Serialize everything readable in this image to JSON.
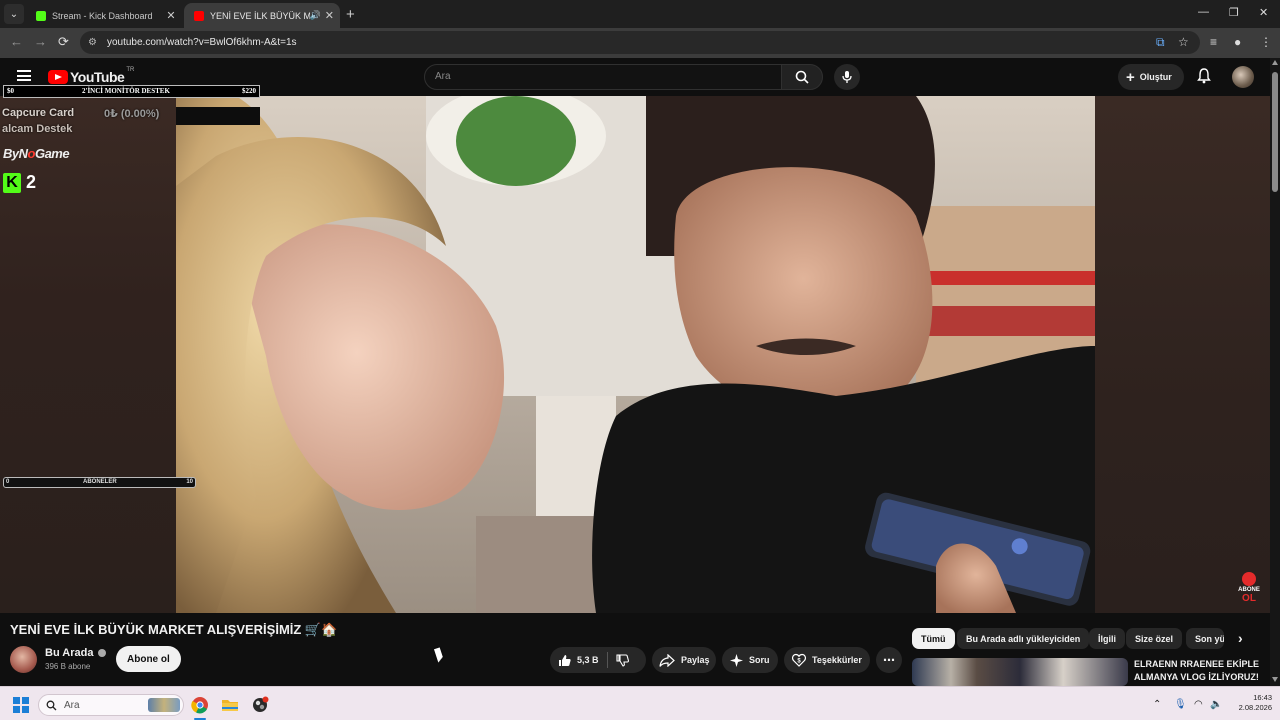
{
  "browser": {
    "tabs": [
      {
        "title": "Stream - Kick Dashboard"
      },
      {
        "title": "YENİ EVE İLK BÜYÜK MARKET ALIŞVERİŞİMİZ"
      }
    ],
    "url": "youtube.com/watch?v=BwlOf6khm-A&t=1s"
  },
  "youtube": {
    "logo_text": "YouTube",
    "country_code": "TR",
    "search_placeholder": "Ara",
    "create_label": "Oluştur"
  },
  "overlay": {
    "goal": {
      "start": "$0",
      "label": "2'İNCİ MONİTÖR DESTEK",
      "end": "$220"
    },
    "capture_card_label": "Capcure Card",
    "capture_card_value": "0₺ (0.00%)",
    "destek_label": "alcam Destek",
    "sponsor": {
      "a": "ByN",
      "b": "o",
      "c": "Game"
    },
    "kick_count": "2",
    "sub_goal": {
      "start": "0",
      "label": "ABONELER",
      "end": "10"
    },
    "abone_top": "ABONE",
    "abone_bottom": "OL"
  },
  "video": {
    "title": "YENİ EVE İLK BÜYÜK MARKET ALIŞVERİŞİMİZ 🛒🏠",
    "channel": "Bu Arada",
    "subscribers": "396 B abone",
    "subscribe_label": "Abone ol",
    "likes": "5,3 B",
    "share_label": "Paylaş",
    "ask_label": "Soru",
    "thanks_label": "Teşekkürler"
  },
  "chips": [
    {
      "label": "Tümü",
      "active": true
    },
    {
      "label": "Bu Arada adlı yükleyiciden"
    },
    {
      "label": "İlgili"
    },
    {
      "label": "Size özel"
    },
    {
      "label": "Son yü"
    }
  ],
  "recommended": {
    "title": "ELRAENN RRAENEE EKİPLE ALMANYA VLOG İZLİYORUZ!"
  },
  "taskbar": {
    "search_placeholder": "Ara",
    "time": "16:43",
    "date": "2.08.2026"
  },
  "colors": {
    "kick_green": "#53fc18",
    "youtube_red": "#ff0000",
    "bg": "#0f0f0f"
  }
}
